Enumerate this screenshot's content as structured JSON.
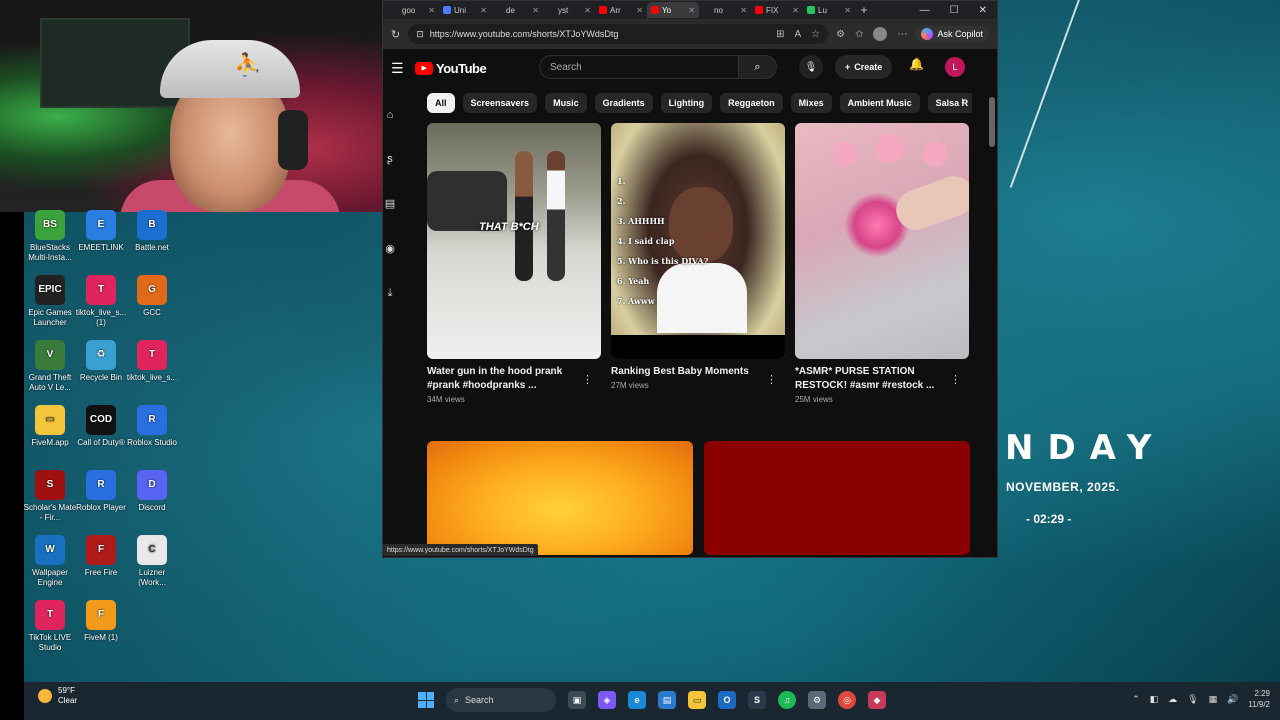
{
  "browser": {
    "tabs": [
      {
        "label": "goo",
        "color": "#202124",
        "active": false
      },
      {
        "label": "Uni",
        "color": "#4a7cff",
        "active": false
      },
      {
        "label": "de",
        "color": "#202124",
        "active": false
      },
      {
        "label": "yst",
        "color": "#202124",
        "active": false
      },
      {
        "label": "Arr",
        "color": "#ff0000",
        "active": false
      },
      {
        "label": "Yo",
        "color": "#ff0000",
        "active": true
      },
      {
        "label": "no",
        "color": "#202124",
        "active": false
      },
      {
        "label": "FIX",
        "color": "#ff0000",
        "active": false
      },
      {
        "label": "Lu",
        "color": "#22c55e",
        "active": false
      }
    ],
    "url": "https://www.youtube.com/shorts/XTJoYWdsDtg",
    "copilot_label": "Ask Copilot",
    "status_url": "https://www.youtube.com/shorts/XTJoYWdsDtg"
  },
  "youtube": {
    "logo_text": "YouTube",
    "search_placeholder": "Search",
    "create_label": "Create",
    "avatar_letter": "L",
    "chips": [
      "All",
      "Screensavers",
      "Music",
      "Gradients",
      "Lighting",
      "Reggaeton",
      "Mixes",
      "Ambient Music",
      "Salsa R"
    ],
    "shorts": [
      {
        "title": "Water gun in the hood prank #prank #hoodpranks ...",
        "views": "34M views",
        "overlay": "THAT B*CH"
      },
      {
        "title": "Ranking Best Baby Moments",
        "views": "27M views",
        "overlay_list": [
          "1.",
          "2.",
          "3. AHHHH",
          "4. I said clap",
          "5. Who is this DIVA?",
          "6. Yeah",
          "7. Awww"
        ]
      },
      {
        "title": "*ASMR* PURSE STATION RESTOCK! #asmr #restock ...",
        "views": "25M views"
      }
    ]
  },
  "desktop": {
    "icons": [
      {
        "label": "BlueStacks Multi-Insta...",
        "color": "#3ca33c",
        "glyph": "BS"
      },
      {
        "label": "EMEETLINK",
        "color": "#2a7de1",
        "glyph": "E"
      },
      {
        "label": "Battle.net",
        "color": "#1a6fd0",
        "glyph": "B"
      },
      {
        "label": "Epic Games Launcher",
        "color": "#222222",
        "glyph": "EPIC"
      },
      {
        "label": "tiktok_live_s... (1)",
        "color": "#e0245e",
        "glyph": "T"
      },
      {
        "label": "GCC",
        "color": "#e06a1a",
        "glyph": "G"
      },
      {
        "label": "Grand Theft Auto V Le...",
        "color": "#3a7a3a",
        "glyph": "V"
      },
      {
        "label": "Recycle Bin",
        "color": "#3aa0d0",
        "glyph": "♻"
      },
      {
        "label": "tiktok_live_s...",
        "color": "#e0245e",
        "glyph": "T"
      },
      {
        "label": "FiveM.app",
        "color": "#f3c53a",
        "glyph": "▭"
      },
      {
        "label": "Call of Duty®",
        "color": "#111111",
        "glyph": "COD"
      },
      {
        "label": "Roblox Studio",
        "color": "#2a6fe0",
        "glyph": "R"
      },
      {
        "label": "Scholar's Mate - Fir...",
        "color": "#a01010",
        "glyph": "S"
      },
      {
        "label": "Roblox Player",
        "color": "#2a6fe0",
        "glyph": "R"
      },
      {
        "label": "Discord",
        "color": "#5865f2",
        "glyph": "D"
      },
      {
        "label": "Wallpaper Engine",
        "color": "#1a70c0",
        "glyph": "W"
      },
      {
        "label": "Free Fire",
        "color": "#b01a1a",
        "glyph": "F"
      },
      {
        "label": "Luizner (Work...",
        "color": "#e8e8e8",
        "glyph": "C"
      },
      {
        "label": "TikTok LIVE Studio",
        "color": "#e0245e",
        "glyph": "T"
      },
      {
        "label": "FiveM (1)",
        "color": "#f39a1a",
        "glyph": "F"
      }
    ]
  },
  "clock": {
    "day": "NDAY",
    "date": "NOVEMBER, 2025.",
    "time": "- 02:29 -"
  },
  "taskbar": {
    "temperature": "59°F",
    "weather": "Clear",
    "search_label": "Search",
    "time": "2:29",
    "date": "11/9/2"
  }
}
